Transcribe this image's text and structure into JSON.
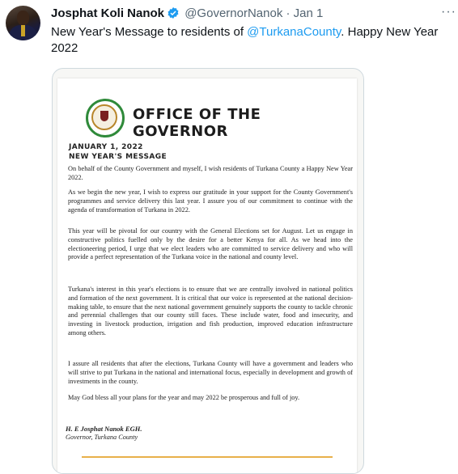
{
  "tweet": {
    "author_name": "Josphat Koli Nanok",
    "handle": "@GovernorNanok",
    "separator": "·",
    "date": "Jan 1",
    "more_label": "···",
    "text_before": "New Year's Message to residents of ",
    "mention": "@TurkanaCounty",
    "text_after": ". Happy New Year 2022"
  },
  "letter": {
    "heading": "OFFICE OF THE GOVERNOR",
    "date": "JANUARY 1, 2022",
    "subject": "NEW YEAR'S MESSAGE",
    "paragraphs": [
      "On behalf of the County Government and myself, I wish residents of Turkana County a Happy New Year 2022.",
      "As we begin the new year, I wish to express our gratitude in your support for the County Government's programmes and service delivery this last year. I assure you of our commitment to continue with the agenda of transformation of Turkana in 2022.",
      "This year will be pivotal for our country with the General Elections set for August. Let us engage in constructive politics fuelled only by the desire for a better Kenya for all. As we head into the electioneering period, I urge that we elect leaders who are committed to service delivery and who will provide a perfect representation of the Turkana voice in the national and county level.",
      "Turkana's interest in this year's elections is to ensure that we are centrally involved in national politics and formation of the next government. It is critical that our voice is represented at the national decision-making table, to ensure that the next national government genuinely supports the county to tackle chronic and perennial challenges that our county still faces. These include water, food and insecurity, and investing in livestock production, irrigation and fish production, improved education infrastructure among others.",
      "I assure all residents that after the elections, Turkana County will have a government and leaders who will strive to put Turkana in the national and international focus, especially in development and growth of investments in the county.",
      "May God bless all your plans for the year and may 2022 be prosperous and full of joy."
    ],
    "signature_name": "H. E Josphat Nanok EGH.",
    "signature_title": "Governor, Turkana County"
  },
  "colors": {
    "link": "#1d9bf0",
    "verified": "#1d9bf0",
    "seal_green": "#2f8a3a",
    "rule_gold": "#e8b04a"
  },
  "icons": {
    "verified": "verified-badge-icon",
    "more": "more-options-icon"
  }
}
